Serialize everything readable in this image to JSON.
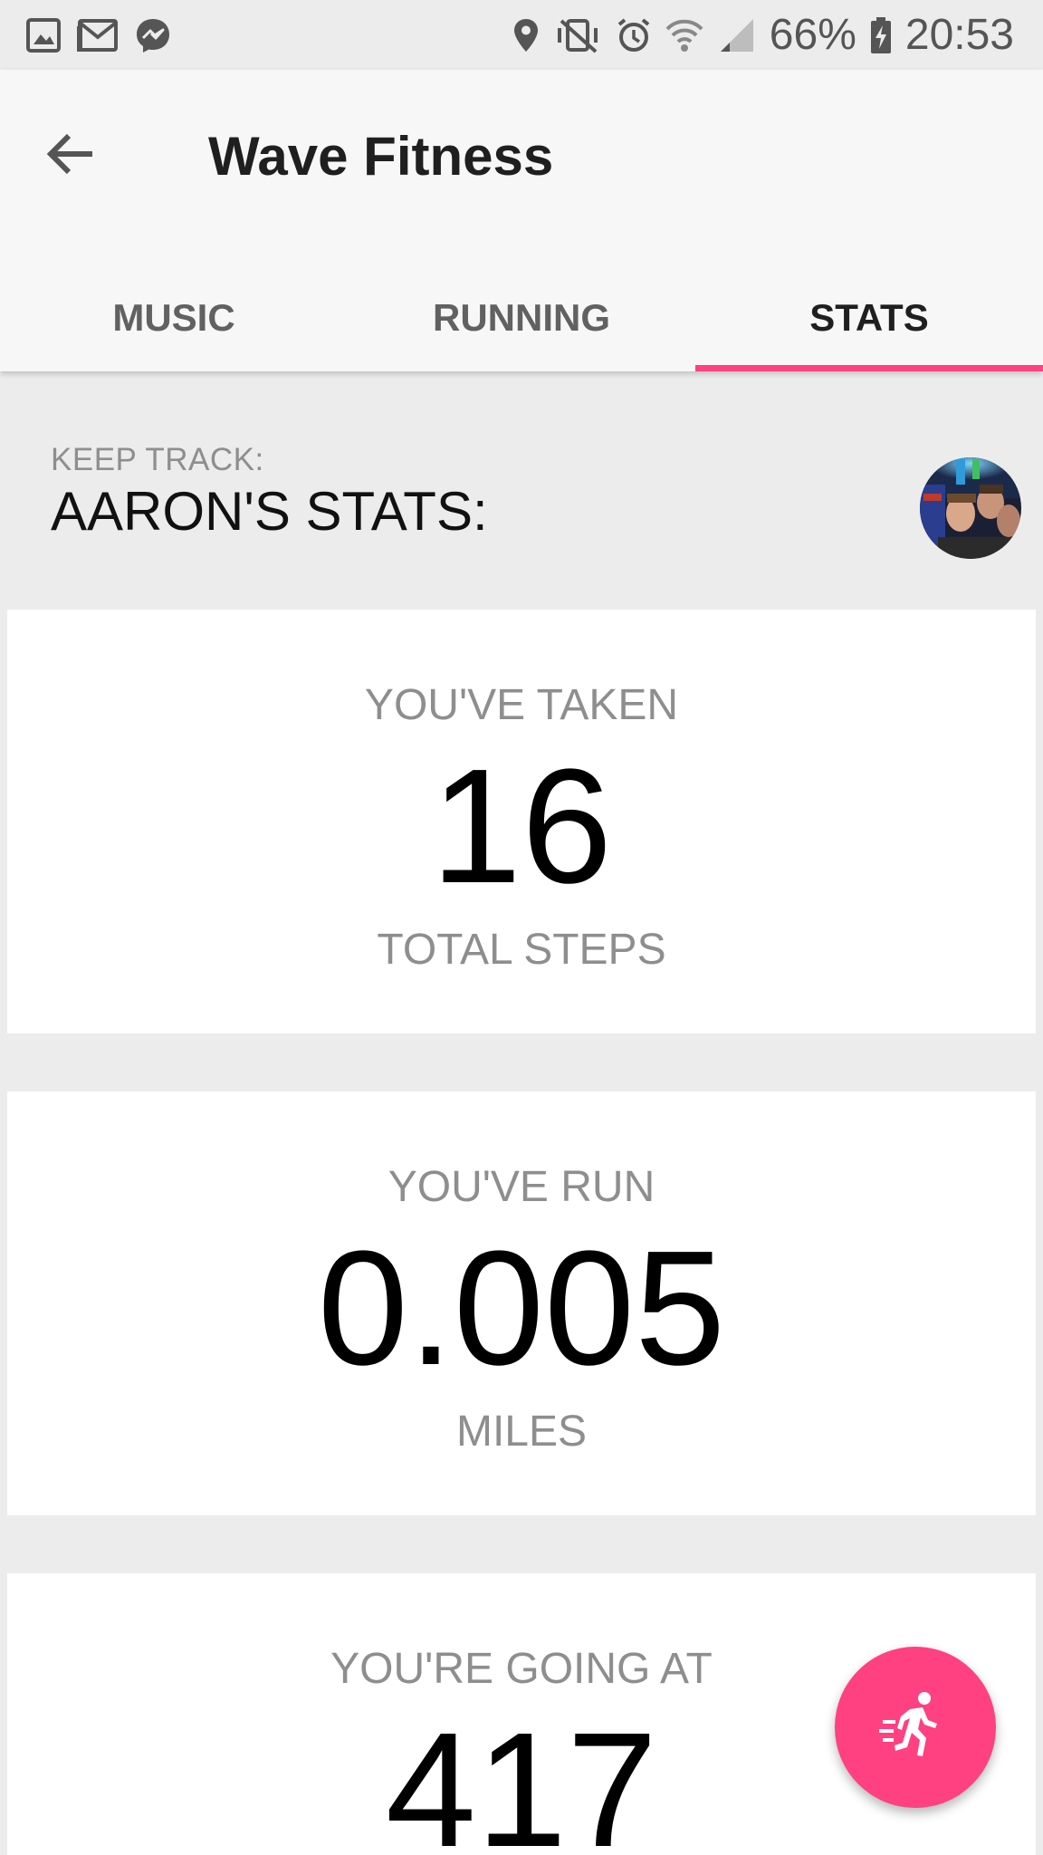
{
  "status_bar": {
    "battery_percent": "66%",
    "time": "20:53",
    "left_icons": [
      "gallery-icon",
      "gmail-icon",
      "messenger-icon"
    ],
    "right_icons": [
      "location-icon",
      "vibrate-mute-icon",
      "alarm-icon",
      "wifi-icon",
      "cellular-signal-icon",
      "battery-charging-icon"
    ]
  },
  "app_bar": {
    "title": "Wave Fitness",
    "back_icon": "arrow-back-icon"
  },
  "tabs": [
    {
      "label": "MUSIC",
      "active": false
    },
    {
      "label": "RUNNING",
      "active": false
    },
    {
      "label": "STATS",
      "active": true
    }
  ],
  "colors": {
    "accent": "#ff4081",
    "background": "#ececec",
    "card": "#ffffff",
    "secondary_text": "#8e8e8e"
  },
  "header": {
    "overline": "KEEP TRACK:",
    "title": "AARON'S STATS:",
    "avatar": "profile-photo"
  },
  "stats": [
    {
      "label": "YOU'VE TAKEN",
      "value": "16",
      "unit": "TOTAL STEPS"
    },
    {
      "label": "YOU'VE RUN",
      "value": "0.005",
      "unit": "MILES"
    },
    {
      "label": "YOU'RE GOING AT",
      "value": "417",
      "unit": ""
    }
  ],
  "fab": {
    "icon": "running-person-icon"
  }
}
